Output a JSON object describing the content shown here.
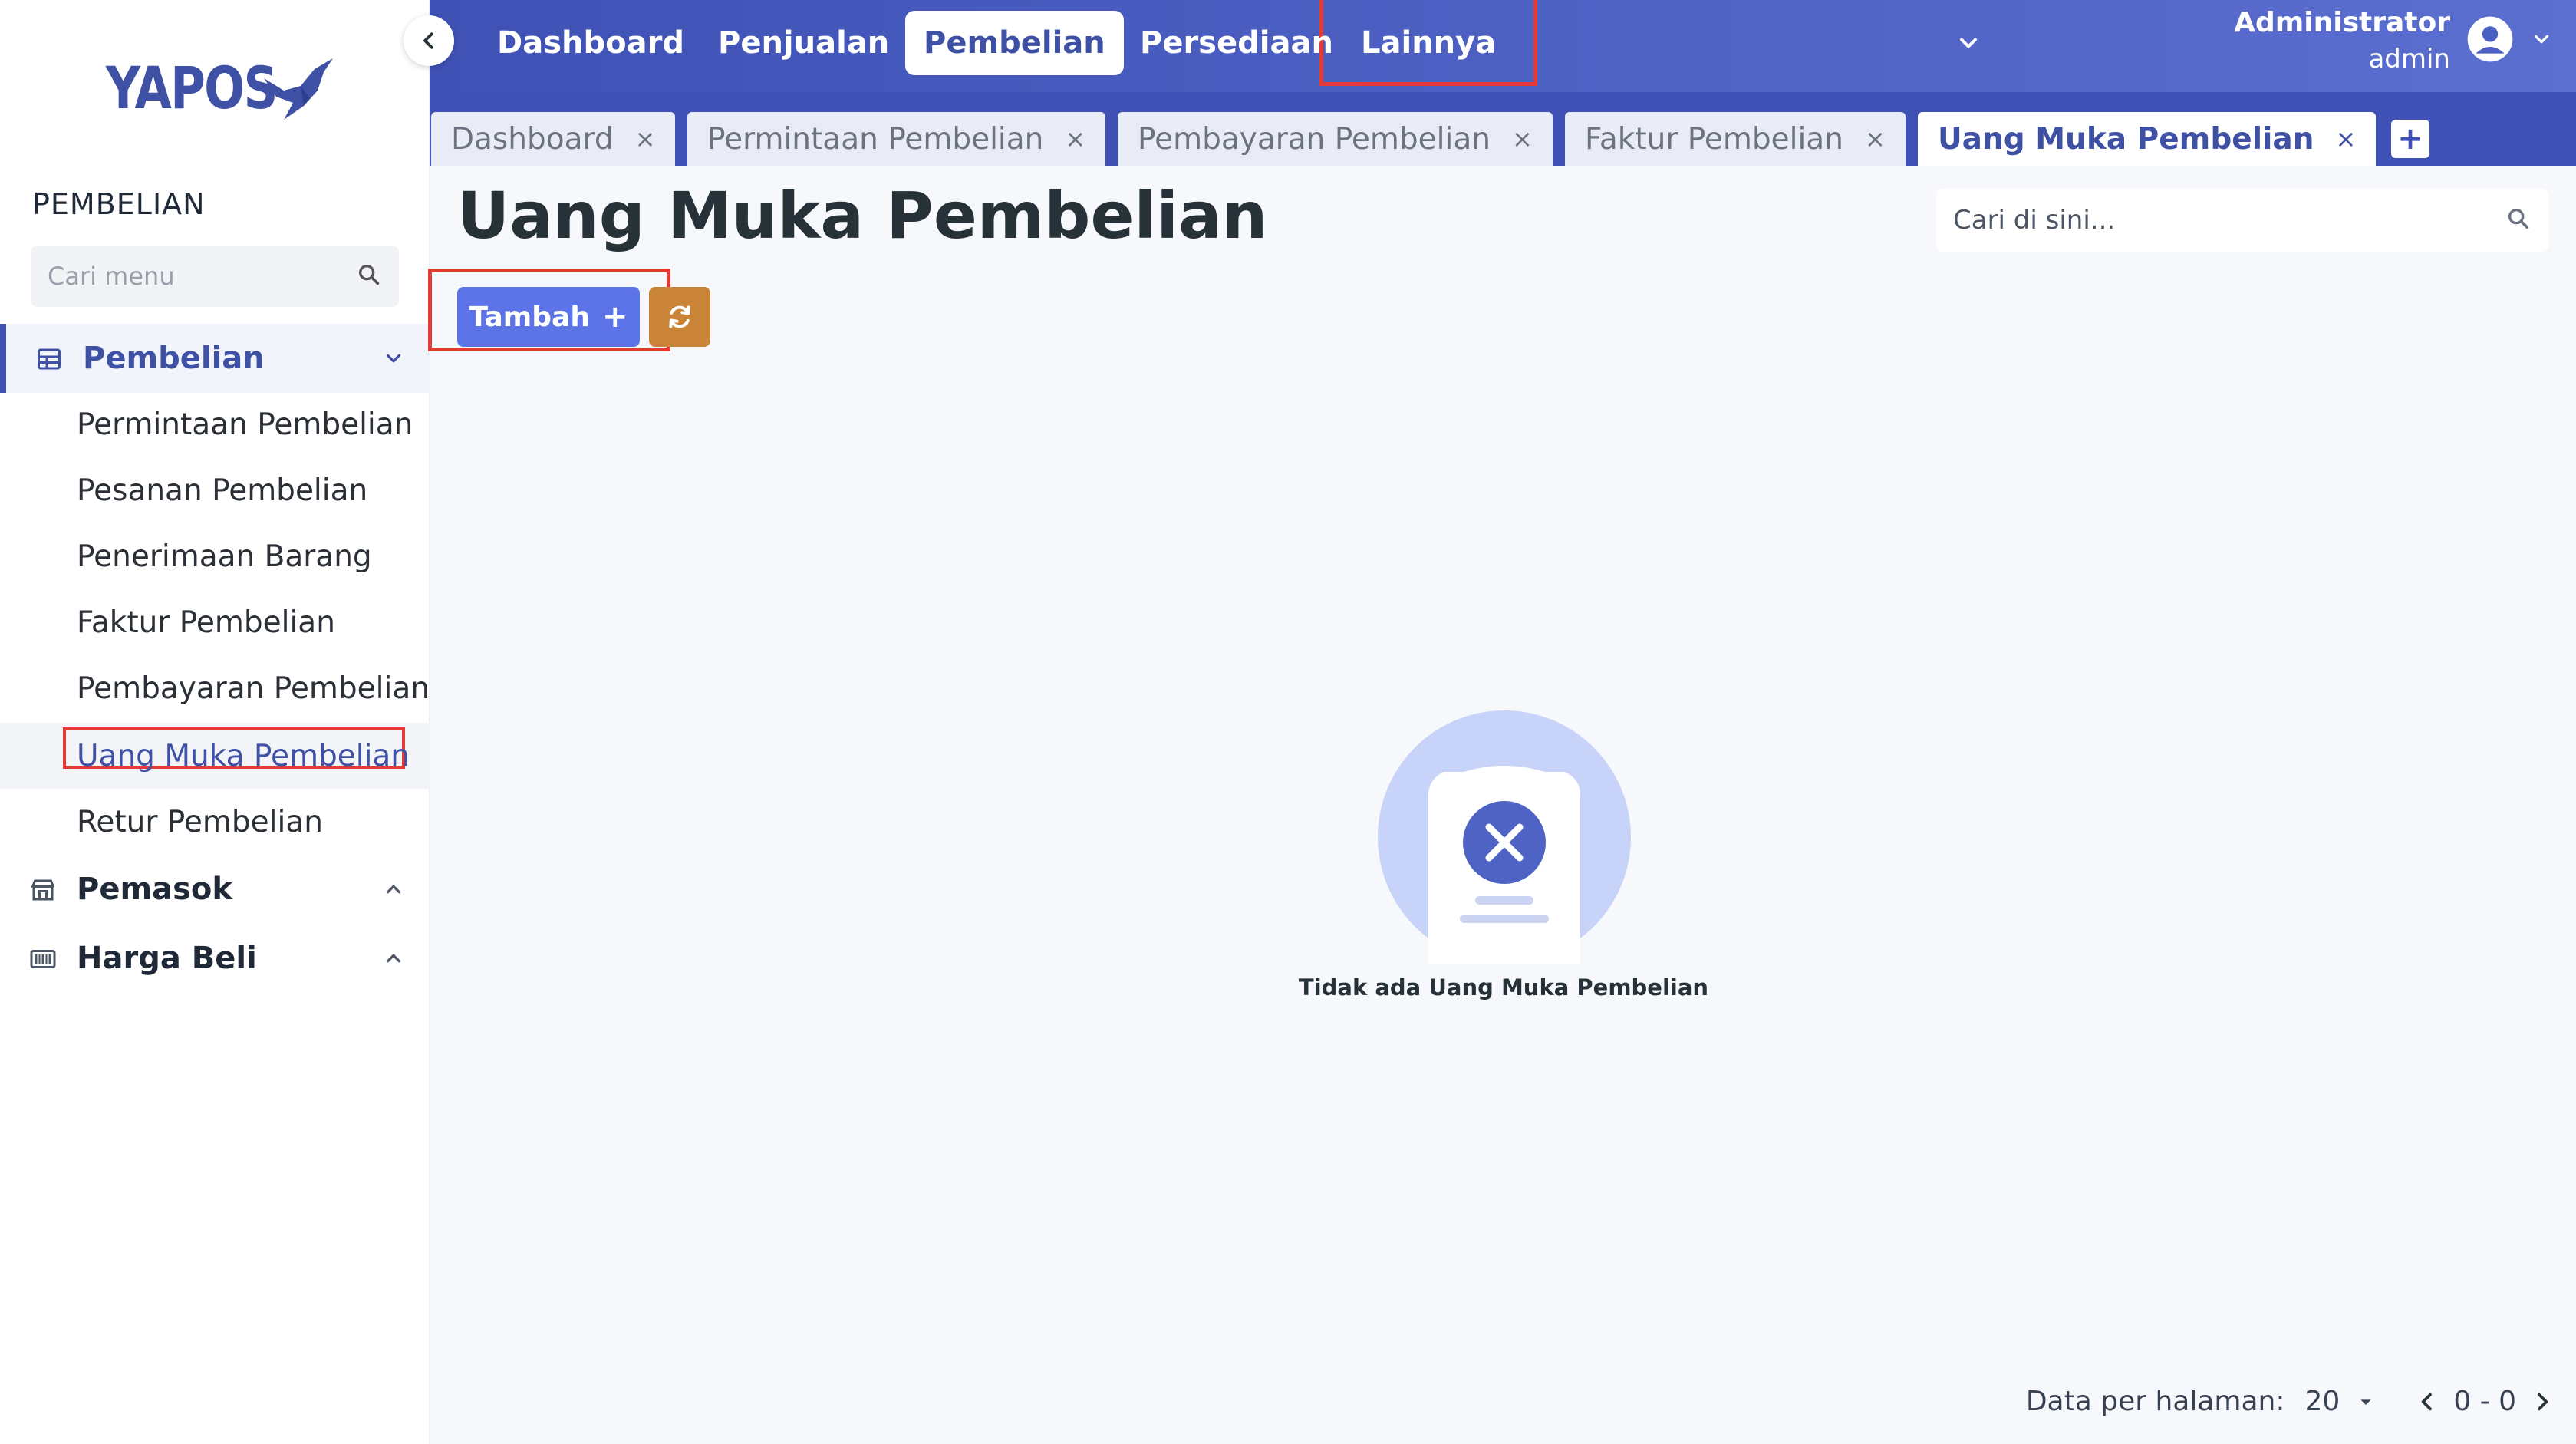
{
  "app": {
    "logo_text": "YAPOS"
  },
  "sidebar": {
    "section_title": "PEMBELIAN",
    "search_placeholder": "Cari menu",
    "groups": [
      {
        "label": "Pembelian",
        "icon": "table-icon",
        "expanded": true,
        "items": [
          {
            "label": "Permintaan Pembelian"
          },
          {
            "label": "Pesanan Pembelian"
          },
          {
            "label": "Penerimaan Barang"
          },
          {
            "label": "Faktur Pembelian"
          },
          {
            "label": "Pembayaran Pembelian"
          },
          {
            "label": "Uang Muka Pembelian",
            "selected": true
          },
          {
            "label": "Retur Pembelian"
          }
        ]
      },
      {
        "label": "Pemasok",
        "icon": "store-icon",
        "expanded": false
      },
      {
        "label": "Harga Beli",
        "icon": "barcode-icon",
        "expanded": false
      }
    ]
  },
  "topnav": {
    "items": [
      {
        "label": "Dashboard"
      },
      {
        "label": "Penjualan"
      },
      {
        "label": "Pembelian",
        "active": true
      },
      {
        "label": "Persediaan"
      },
      {
        "label": "Lainnya"
      }
    ]
  },
  "user": {
    "name": "Administrator",
    "role": "admin"
  },
  "tabs": [
    {
      "label": "Dashboard"
    },
    {
      "label": "Permintaan Pembelian"
    },
    {
      "label": "Pembayaran Pembelian"
    },
    {
      "label": "Faktur Pembelian"
    },
    {
      "label": "Uang Muka Pembelian",
      "active": true
    }
  ],
  "tab_close_glyph": "×",
  "main": {
    "title": "Uang Muka Pembelian",
    "search_placeholder": "Cari di sini...",
    "add_label": "Tambah",
    "empty_text": "Tidak ada Uang Muka Pembelian"
  },
  "pagination": {
    "per_page_label": "Data per halaman:",
    "per_page_value": "20",
    "range": "0 - 0"
  },
  "colors": {
    "primary": "#3f51b5",
    "button": "#5c74e8",
    "refresh": "#c98437",
    "highlight": "#e53935"
  }
}
